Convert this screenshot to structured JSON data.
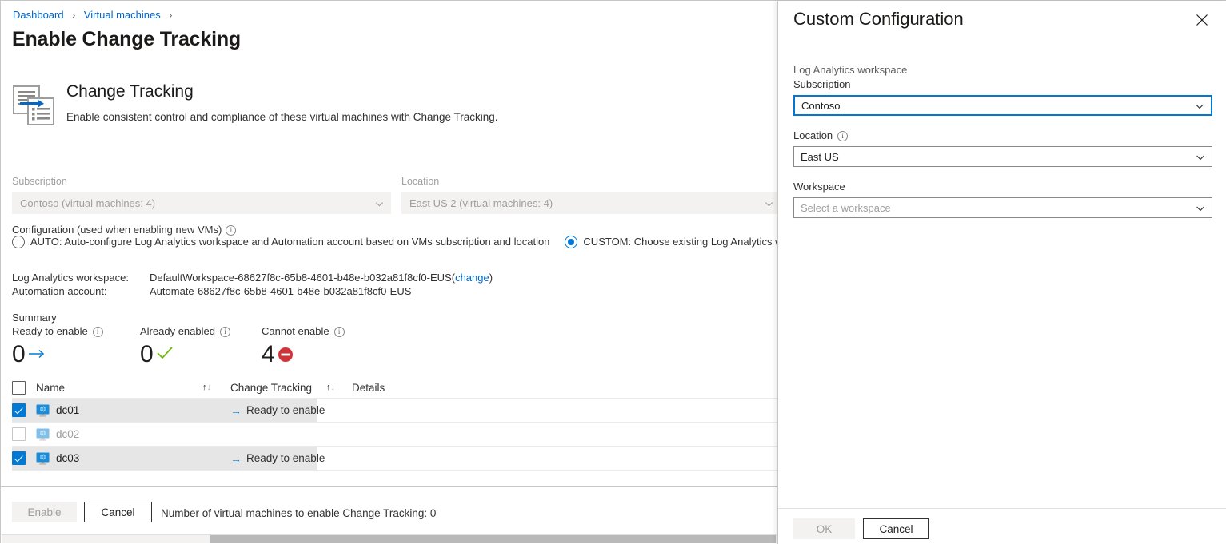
{
  "breadcrumb": {
    "items": [
      {
        "label": "Dashboard"
      },
      {
        "label": "Virtual machines"
      }
    ],
    "separator": "›"
  },
  "page": {
    "title": "Enable Change Tracking"
  },
  "hero": {
    "icon": "change-tracking-icon",
    "title": "Change Tracking",
    "subtitle": "Enable consistent control and compliance of these virtual machines with Change Tracking."
  },
  "filters": {
    "subscription": {
      "label": "Subscription",
      "value": "Contoso (virtual machines: 4)"
    },
    "location": {
      "label": "Location",
      "value": "East US 2 (virtual machines: 4)"
    }
  },
  "configuration": {
    "label": "Configuration (used when enabling new VMs)",
    "info_icon": "info-icon",
    "options": [
      {
        "id": "auto",
        "label": "AUTO: Auto-configure Log Analytics workspace and Automation account based on VMs subscription and location",
        "selected": false
      },
      {
        "id": "custom",
        "label": "CUSTOM: Choose existing Log Analytics workspace and Automation account",
        "selected": true
      }
    ]
  },
  "workspace_info": {
    "log_analytics_label": "Log Analytics workspace:",
    "log_analytics_value": "DefaultWorkspace-68627f8c-65b8-4601-b48e-b032a81f8cf0-EUS",
    "change_link_open": "(",
    "change_link": "change",
    "change_link_close": ")",
    "automation_label": "Automation account:",
    "automation_value": "Automate-68627f8c-65b8-4601-b48e-b032a81f8cf0-EUS"
  },
  "summary": {
    "title": "Summary",
    "cards": [
      {
        "label": "Ready to enable",
        "value": "0",
        "icon": "arrow-right-icon",
        "info_icon": "info-icon"
      },
      {
        "label": "Already enabled",
        "value": "0",
        "icon": "checkmark-icon",
        "info_icon": "info-icon"
      },
      {
        "label": "Cannot enable",
        "value": "4",
        "icon": "blocked-icon",
        "info_icon": "info-icon"
      }
    ]
  },
  "table": {
    "columns": [
      {
        "key": "name",
        "label": "Name",
        "sortable": true
      },
      {
        "key": "change_tracking",
        "label": "Change Tracking",
        "sortable": true
      },
      {
        "key": "details",
        "label": "Details",
        "sortable": false
      }
    ],
    "select_all_checked": false,
    "sort_icon": "sort-updown-icon",
    "rows": [
      {
        "name": "dc01",
        "checked": true,
        "enabled": true,
        "change_tracking": "Ready to enable",
        "status_icon": "arrow-right-icon",
        "details": ""
      },
      {
        "name": "dc02",
        "checked": false,
        "enabled": false,
        "change_tracking": "",
        "status_icon": "",
        "details": ""
      },
      {
        "name": "dc03",
        "checked": true,
        "enabled": true,
        "change_tracking": "Ready to enable",
        "status_icon": "arrow-right-icon",
        "details": ""
      }
    ]
  },
  "footer": {
    "enable_label": "Enable",
    "cancel_label": "Cancel",
    "note": "Number of virtual machines to enable Change Tracking: 0"
  },
  "panel": {
    "title": "Custom Configuration",
    "close_icon": "close-icon",
    "group_label": "Log Analytics workspace",
    "fields": [
      {
        "id": "subscription",
        "label": "Subscription",
        "value": "Contoso",
        "placeholder": "",
        "focused": true,
        "has_info": false
      },
      {
        "id": "location",
        "label": "Location",
        "value": "East US",
        "placeholder": "",
        "focused": false,
        "has_info": true
      },
      {
        "id": "workspace",
        "label": "Workspace",
        "value": "",
        "placeholder": "Select a workspace",
        "focused": false,
        "has_info": false
      }
    ],
    "ok_label": "OK",
    "cancel_label": "Cancel"
  },
  "colors": {
    "accent": "#0078d4",
    "link": "#0066cc",
    "error": "#d13438",
    "success": "#6bb700",
    "row_selected": "#e6e6e6",
    "disabled_bg": "#f3f2f1"
  }
}
